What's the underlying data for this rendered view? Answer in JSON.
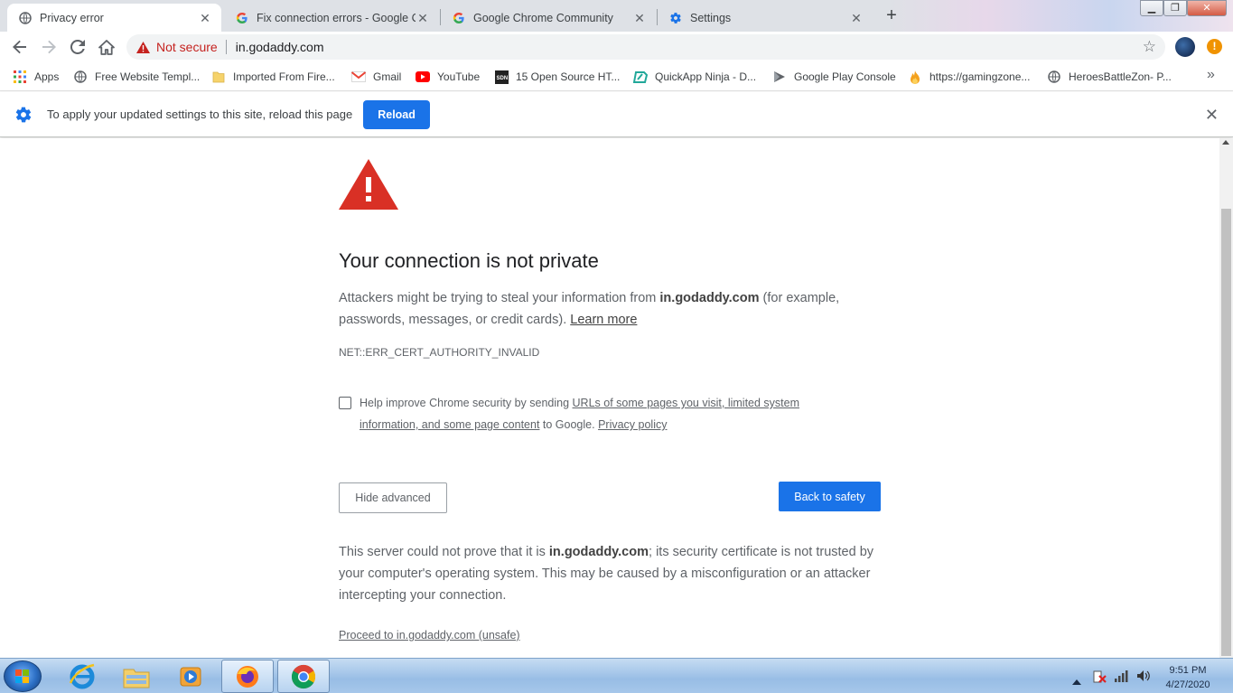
{
  "tabs": [
    {
      "title": "Privacy error",
      "favicon": "globe-icon",
      "active": true
    },
    {
      "title": "Fix connection errors - Google Ch",
      "favicon": "google-g-icon",
      "active": false
    },
    {
      "title": "Google Chrome Community",
      "favicon": "google-g-icon",
      "active": false
    },
    {
      "title": "Settings",
      "favicon": "gear-icon",
      "active": false
    }
  ],
  "omnibox": {
    "security_label": "Not secure",
    "url": "in.godaddy.com"
  },
  "bookmarks": [
    {
      "label": "Apps",
      "icon": "apps-grid-icon"
    },
    {
      "label": "Free Website Templ...",
      "icon": "globe-icon"
    },
    {
      "label": "Imported From Fire...",
      "icon": "folder-icon"
    },
    {
      "label": "Gmail",
      "icon": "gmail-icon"
    },
    {
      "label": "YouTube",
      "icon": "youtube-icon"
    },
    {
      "label": "15 Open Source HT...",
      "icon": "sdn-icon"
    },
    {
      "label": "QuickApp Ninja - D...",
      "icon": "quickapp-icon"
    },
    {
      "label": "Google Play Console",
      "icon": "play-console-icon"
    },
    {
      "label": "https://gamingzone...",
      "icon": "flame-icon"
    },
    {
      "label": "HeroesBattleZon- P...",
      "icon": "globe-icon"
    }
  ],
  "infobar": {
    "message": "To apply your updated settings to this site, reload this page",
    "reload_label": "Reload"
  },
  "interstitial": {
    "heading": "Your connection is not private",
    "p1_before": "Attackers might be trying to steal your information from ",
    "domain": "in.godaddy.com",
    "p1_after": " (for example, passwords, messages, or credit cards). ",
    "learn_more": "Learn more",
    "error_code": "NET::ERR_CERT_AUTHORITY_INVALID",
    "checkbox_before": "Help improve Chrome security by sending ",
    "checkbox_link": "URLs of some pages you visit, limited system information, and some page content",
    "checkbox_middle": " to Google. ",
    "privacy_policy": "Privacy policy",
    "hide_advanced": "Hide advanced",
    "back_to_safety": "Back to safety",
    "details_before": "This server could not prove that it is ",
    "details_after": "; its security certificate is not trusted by your computer's operating system. This may be caused by a misconfiguration or an attacker intercepting your connection.",
    "proceed": "Proceed to in.godaddy.com (unsafe)"
  },
  "taskbar": {
    "apps": [
      "internet-explorer-icon",
      "file-explorer-icon",
      "media-player-icon",
      "firefox-icon",
      "chrome-icon"
    ],
    "time": "9:51 PM",
    "date": "4/27/2020"
  },
  "colors": {
    "accent": "#1a73e8",
    "warning_red": "#d93025",
    "not_secure_red": "#c5221f"
  }
}
